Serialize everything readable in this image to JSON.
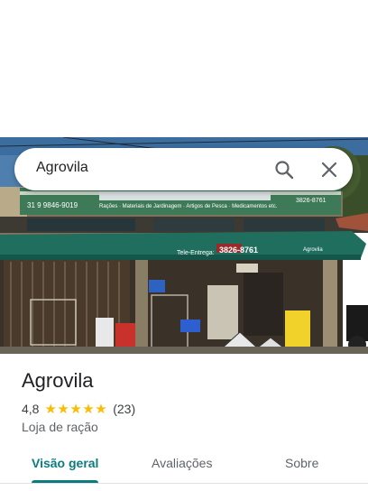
{
  "search": {
    "query": "Agrovila"
  },
  "photo": {
    "sign_left_phone": "31 9 9846-9019",
    "sign_products": "Rações · Materiais de Jardinagem · Artigos de Pesca · Medicamentos etc.",
    "sign_right_phone": "3826-8761",
    "awning_label": "Tele-Entrega:",
    "awning_phone": "3826-8761",
    "awning_brand": "Agrovila"
  },
  "place": {
    "name": "Agrovila",
    "rating": "4,8",
    "stars": "★★★★★",
    "review_count": "(23)",
    "category": "Loja de ração"
  },
  "tabs": [
    {
      "label": "Visão geral",
      "active": true
    },
    {
      "label": "Avaliações",
      "active": false
    },
    {
      "label": "Sobre",
      "active": false
    }
  ]
}
